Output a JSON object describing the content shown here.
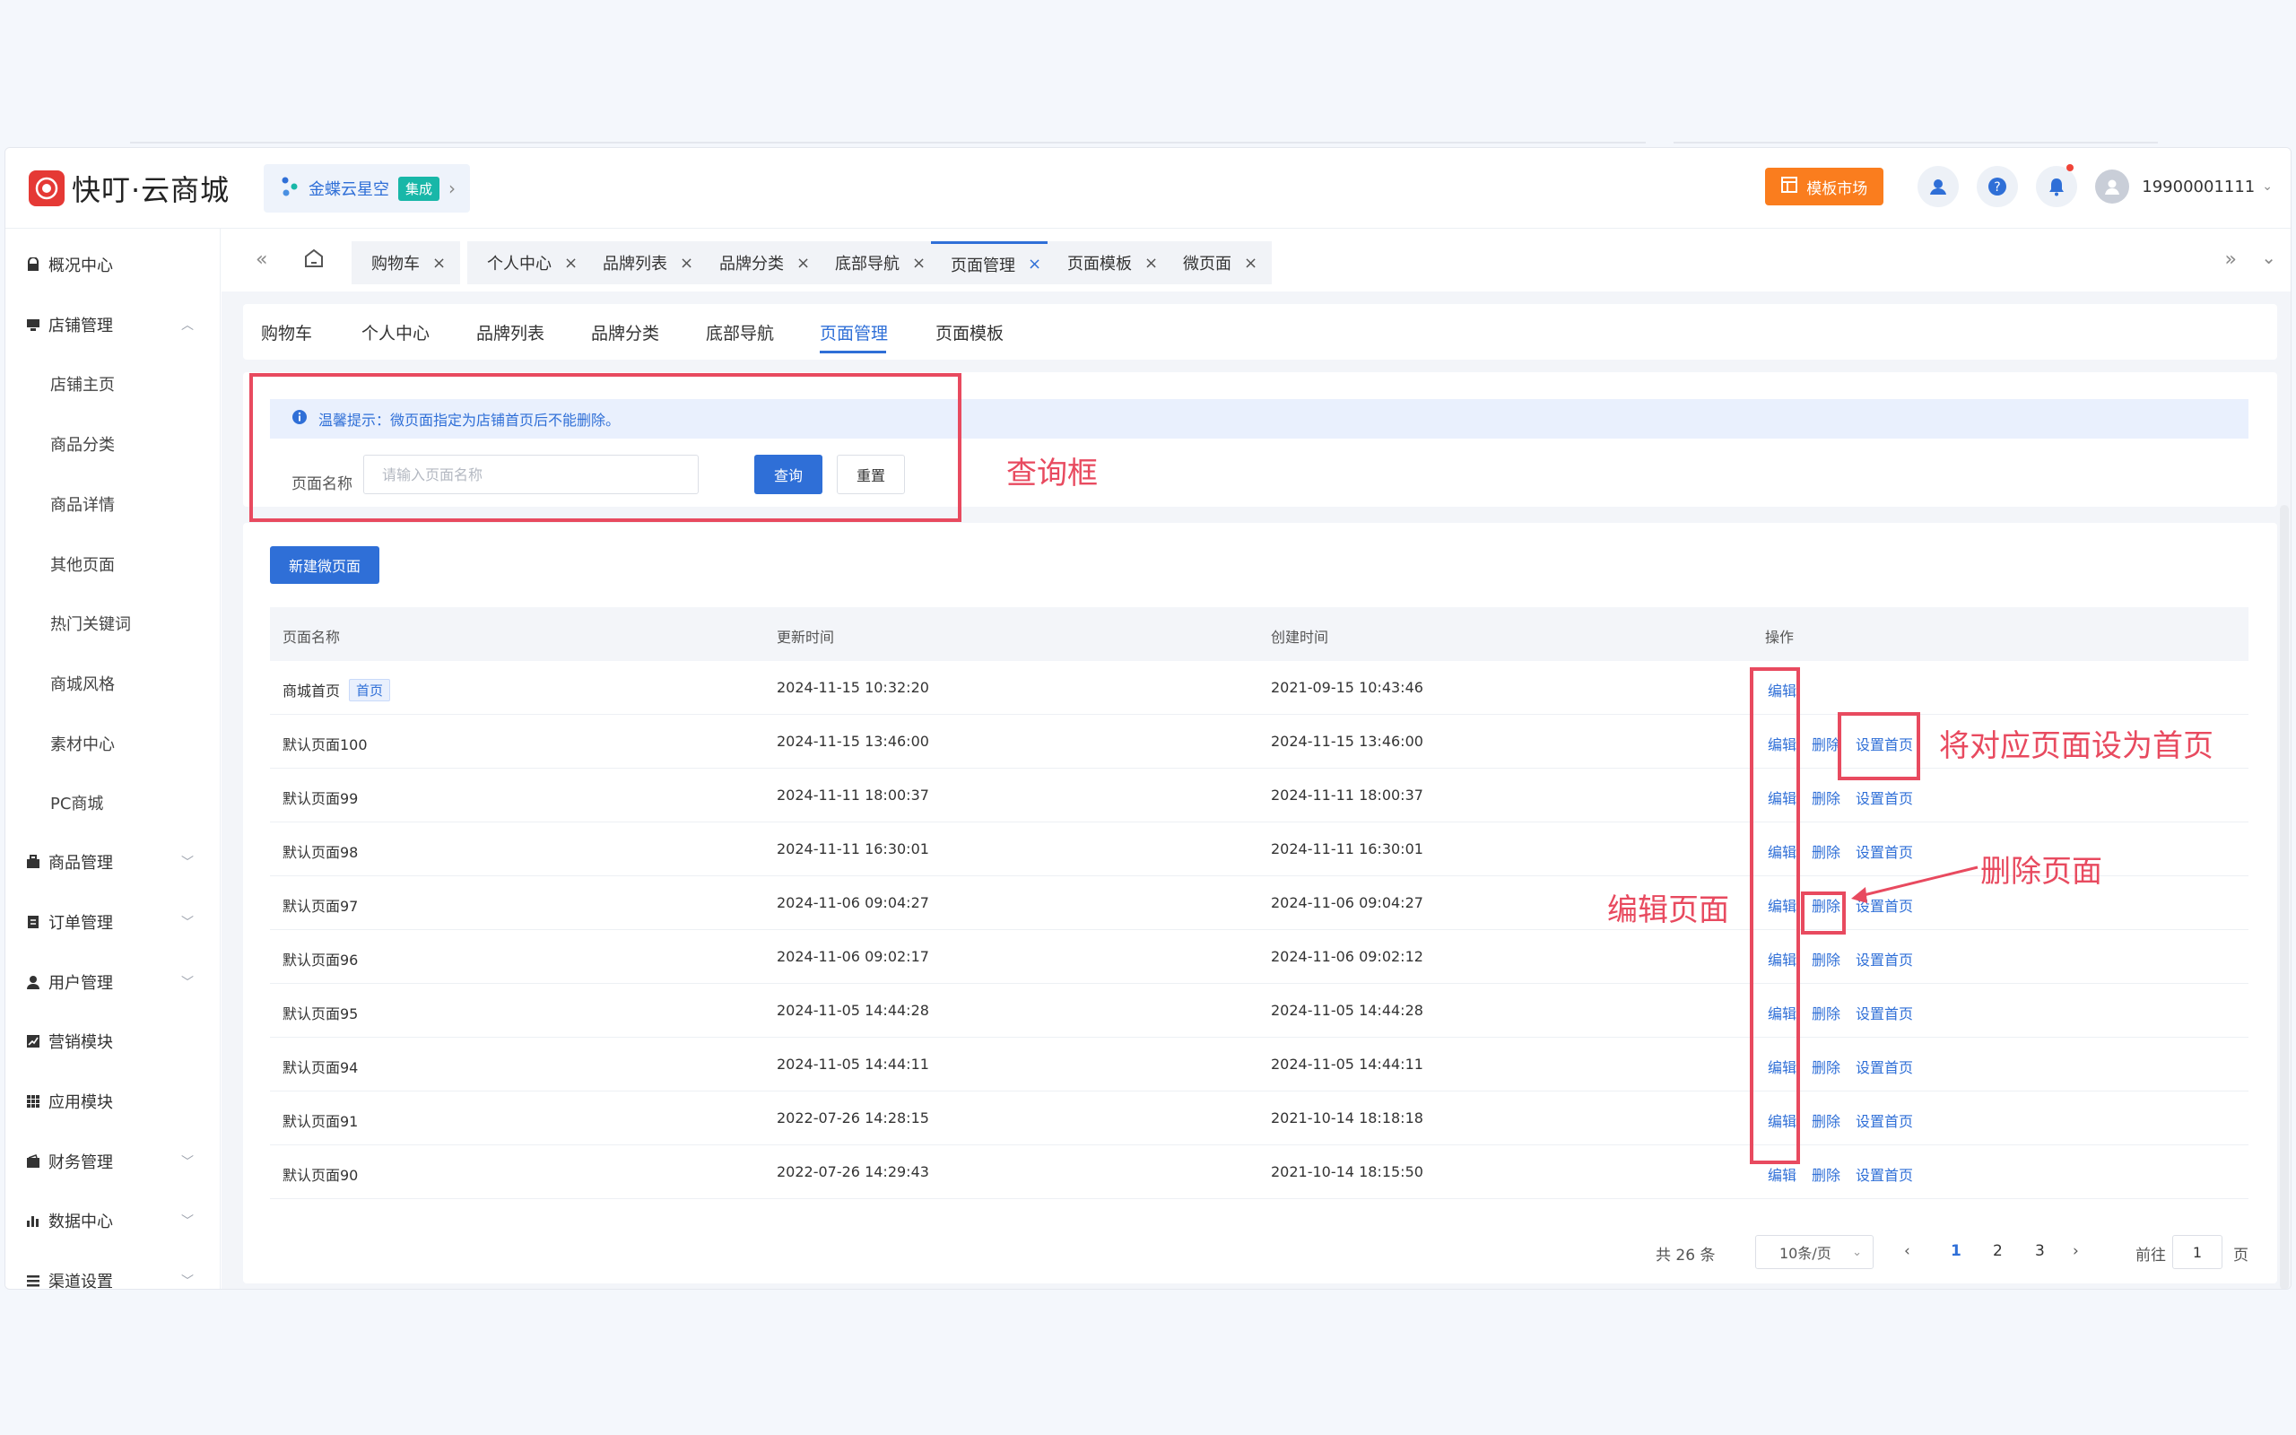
{
  "header": {
    "brand": "快叮·云商城",
    "kingdee": {
      "name": "金蝶云星空",
      "tag": "集成"
    },
    "template_market": "模板市场",
    "user": "19900001111"
  },
  "sidebar": {
    "items": [
      {
        "label": "概况中心"
      },
      {
        "label": "店铺管理"
      },
      {
        "label": "店铺主页"
      },
      {
        "label": "商品分类"
      },
      {
        "label": "商品详情"
      },
      {
        "label": "其他页面"
      },
      {
        "label": "热门关键词"
      },
      {
        "label": "商城风格"
      },
      {
        "label": "素材中心"
      },
      {
        "label": "PC商城"
      },
      {
        "label": "商品管理"
      },
      {
        "label": "订单管理"
      },
      {
        "label": "用户管理"
      },
      {
        "label": "营销模块"
      },
      {
        "label": "应用模块"
      },
      {
        "label": "财务管理"
      },
      {
        "label": "数据中心"
      },
      {
        "label": "渠道设置"
      }
    ]
  },
  "page_tabs": [
    "购物车",
    "个人中心",
    "品牌列表",
    "品牌分类",
    "底部导航",
    "页面管理",
    "页面模板",
    "微页面"
  ],
  "sub_tabs": [
    "购物车",
    "个人中心",
    "品牌列表",
    "品牌分类",
    "底部导航",
    "页面管理",
    "页面模板"
  ],
  "query": {
    "tip": "温馨提示：微页面指定为店铺首页后不能删除。",
    "label": "页面名称",
    "placeholder": "请输入页面名称",
    "query_btn": "查询",
    "reset_btn": "重置"
  },
  "list": {
    "new_btn": "新建微页面",
    "columns": [
      "页面名称",
      "更新时间",
      "创建时间",
      "操作"
    ],
    "rows": [
      {
        "name": "商城首页",
        "badge": "首页",
        "updated": "2024-11-15 10:32:20",
        "created": "2021-09-15 10:43:46"
      },
      {
        "name": "默认页面100",
        "updated": "2024-11-15 13:46:00",
        "created": "2024-11-15 13:46:00"
      },
      {
        "name": "默认页面99",
        "updated": "2024-11-11 18:00:37",
        "created": "2024-11-11 18:00:37"
      },
      {
        "name": "默认页面98",
        "updated": "2024-11-11 16:30:01",
        "created": "2024-11-11 16:30:01"
      },
      {
        "name": "默认页面97",
        "updated": "2024-11-06 09:04:27",
        "created": "2024-11-06 09:04:27"
      },
      {
        "name": "默认页面96",
        "updated": "2024-11-06 09:02:17",
        "created": "2024-11-06 09:02:12"
      },
      {
        "name": "默认页面95",
        "updated": "2024-11-05 14:44:28",
        "created": "2024-11-05 14:44:28"
      },
      {
        "name": "默认页面94",
        "updated": "2024-11-05 14:44:11",
        "created": "2024-11-05 14:44:11"
      },
      {
        "name": "默认页面91",
        "updated": "2022-07-26 14:28:15",
        "created": "2021-10-14 18:18:18"
      },
      {
        "name": "默认页面90",
        "updated": "2022-07-26 14:29:43",
        "created": "2021-10-14 18:15:50"
      }
    ],
    "ops": {
      "edit": "编辑",
      "delete": "删除",
      "set_home": "设置首页"
    }
  },
  "pager": {
    "total": "共 26 条",
    "page_size": "10条/页",
    "pages": [
      "1",
      "2",
      "3"
    ],
    "current": "1",
    "goto_label": "前往",
    "goto_value": "1",
    "page_unit": "页"
  },
  "annotations": {
    "query_box": "查询框",
    "set_home": "将对应页面设为首页",
    "delete": "删除页面",
    "edit": "编辑页面"
  },
  "colors": {
    "accent": "#2f6fd7",
    "annotation": "#e84a5f",
    "template_button": "#fa7d1e",
    "brand": "#e53935"
  }
}
